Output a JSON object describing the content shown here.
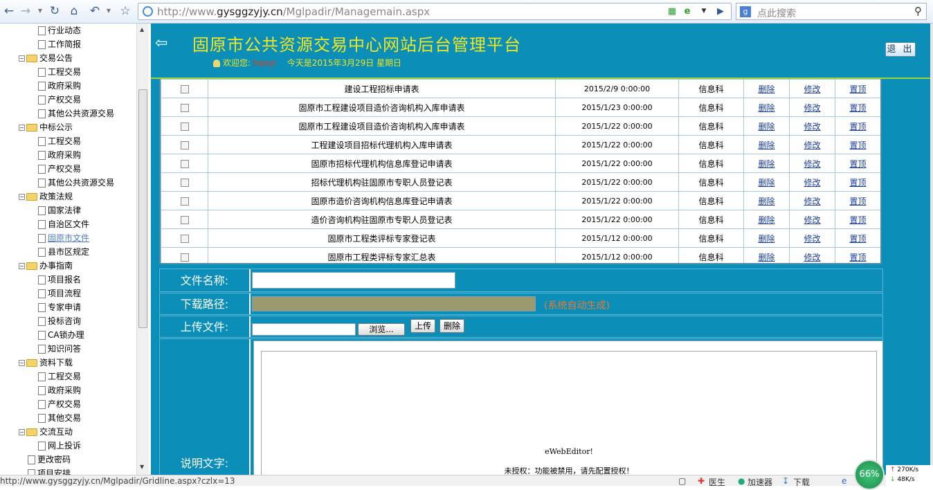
{
  "browser": {
    "url_prefix": "http://www.",
    "url_domain": "gysggzyjy.cn",
    "url_path": "/Mglpadir/Managemain.aspx",
    "search_placeholder": "点此搜索",
    "status_url": "http://www.gysggzyjy.cn/Mglpadir/Gridline.aspx?czlx=13",
    "status_items": [
      "医生",
      "加速器",
      "下载"
    ],
    "speed_percent": "66%",
    "net_up": "270K/s",
    "net_down": "48K/s"
  },
  "sidebar": {
    "items": [
      {
        "label": "行业动态",
        "type": "page",
        "level": 2
      },
      {
        "label": "工作简报",
        "type": "page",
        "level": 2
      },
      {
        "label": "交易公告",
        "type": "folder",
        "level": 1
      },
      {
        "label": "工程交易",
        "type": "page",
        "level": 2
      },
      {
        "label": "政府采购",
        "type": "page",
        "level": 2
      },
      {
        "label": "产权交易",
        "type": "page",
        "level": 2
      },
      {
        "label": "其他公共资源交易",
        "type": "page",
        "level": 2
      },
      {
        "label": "中标公示",
        "type": "folder",
        "level": 1
      },
      {
        "label": "工程交易",
        "type": "page",
        "level": 2
      },
      {
        "label": "政府采购",
        "type": "page",
        "level": 2
      },
      {
        "label": "产权交易",
        "type": "page",
        "level": 2
      },
      {
        "label": "其他公共资源交易",
        "type": "page",
        "level": 2
      },
      {
        "label": "政策法规",
        "type": "folder",
        "level": 1
      },
      {
        "label": "国家法律",
        "type": "page",
        "level": 2
      },
      {
        "label": "自治区文件",
        "type": "page",
        "level": 2
      },
      {
        "label": "固原市文件",
        "type": "page",
        "level": 2,
        "active": true
      },
      {
        "label": "县市区规定",
        "type": "page",
        "level": 2
      },
      {
        "label": "办事指南",
        "type": "folder",
        "level": 1
      },
      {
        "label": "项目报名",
        "type": "page",
        "level": 2
      },
      {
        "label": "项目流程",
        "type": "page",
        "level": 2
      },
      {
        "label": "专家申请",
        "type": "page",
        "level": 2
      },
      {
        "label": "投标咨询",
        "type": "page",
        "level": 2
      },
      {
        "label": "CA锁办理",
        "type": "page",
        "level": 2
      },
      {
        "label": "知识问答",
        "type": "page",
        "level": 2
      },
      {
        "label": "资料下载",
        "type": "folder",
        "level": 1
      },
      {
        "label": "工程交易",
        "type": "page",
        "level": 2
      },
      {
        "label": "政府采购",
        "type": "page",
        "level": 2
      },
      {
        "label": "产权交易",
        "type": "page",
        "level": 2
      },
      {
        "label": "其他交易",
        "type": "page",
        "level": 2
      },
      {
        "label": "交流互动",
        "type": "folder",
        "level": 1
      },
      {
        "label": "网上投诉",
        "type": "page",
        "level": 2
      },
      {
        "label": "更改密码",
        "type": "page",
        "level": 1
      },
      {
        "label": "项目安排",
        "type": "page",
        "level": 1
      }
    ]
  },
  "header": {
    "title": "固原市公共资源交易中心网站后台管理平台",
    "welcome_label": "欢迎您:",
    "username": "haoyi",
    "date_text": "今天是2015年3月29日   星期日",
    "logout_label": "退 出"
  },
  "grid": {
    "actions": [
      "删除",
      "修改",
      "置顶"
    ],
    "rows": [
      {
        "name": "建设工程招标申请表",
        "date": "2015/2/9 0:00:00",
        "dept": "信息科"
      },
      {
        "name": "固原市工程建设项目造价咨询机构入库申请表",
        "date": "2015/1/23 0:00:00",
        "dept": "信息科"
      },
      {
        "name": "固原市工程建设项目造价咨询机构入库申请表",
        "date": "2015/1/22 0:00:00",
        "dept": "信息科"
      },
      {
        "name": "工程建设项目招标代理机构入库申请表",
        "date": "2015/1/22 0:00:00",
        "dept": "信息科"
      },
      {
        "name": "固原市招标代理机构信息库登记申请表",
        "date": "2015/1/22 0:00:00",
        "dept": "信息科"
      },
      {
        "name": "招标代理机构驻固原市专职人员登记表",
        "date": "2015/1/22 0:00:00",
        "dept": "信息科"
      },
      {
        "name": "固原市造价咨询机构信息库登记申请表",
        "date": "2015/1/22 0:00:00",
        "dept": "信息科"
      },
      {
        "name": "造价咨询机构驻固原市专职人员登记表",
        "date": "2015/1/22 0:00:00",
        "dept": "信息科"
      },
      {
        "name": "固原市工程类评标专家登记表",
        "date": "2015/1/12 0:00:00",
        "dept": "信息科"
      },
      {
        "name": "固原市工程类评标专家汇总表",
        "date": "2015/1/12 0:00:00",
        "dept": "信息科"
      }
    ]
  },
  "form": {
    "file_name_label": "文件名称:",
    "file_name_value": "",
    "download_path_label": "下载路径:",
    "auto_note": "(系统自动生成)",
    "upload_label": "上传文件:",
    "browse_label": "浏览...",
    "upload_button": "上传",
    "delete_button": "删除",
    "desc_label": "说明文字:",
    "editor_title": "eWebEditor!",
    "editor_msg": "未授权：功能被禁用，请先配置授权！"
  }
}
